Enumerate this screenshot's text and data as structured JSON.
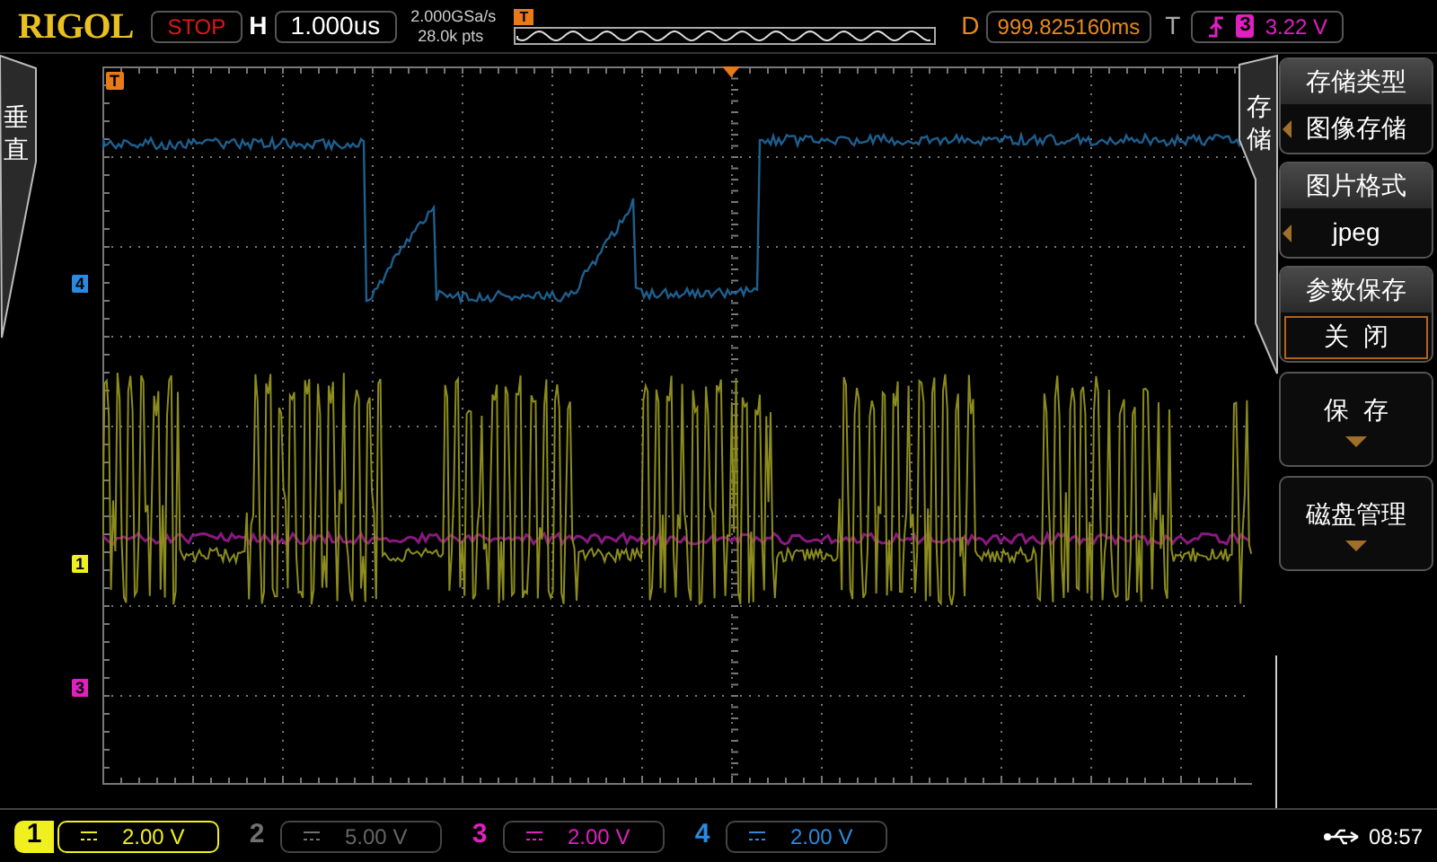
{
  "header": {
    "logo": "RIGOL",
    "run_state": "STOP",
    "timebase_label": "H",
    "timebase": "1.000us",
    "sample_rate": "2.000GSa/s",
    "memory_depth": "28.0k pts",
    "overview_trigger_mark": "T",
    "delay_label": "D",
    "delay": "999.825160ms",
    "trigger_label": "T",
    "trigger_source": "3",
    "trigger_level": "3.22 V"
  },
  "left_tab": {
    "label": "垂直"
  },
  "markers": [
    {
      "kind": "trigger",
      "label": "T",
      "color": "#e87a1a"
    },
    {
      "kind": "channel",
      "label": "4",
      "color": "#2a8ae0"
    },
    {
      "kind": "channel",
      "label": "1",
      "color": "#f0f020"
    },
    {
      "kind": "channel",
      "label": "3",
      "color": "#e020c0"
    }
  ],
  "menu": {
    "tab": "存储",
    "items": [
      {
        "kind": "option",
        "title": "存储类型",
        "value": "图像存储",
        "selected": false
      },
      {
        "kind": "option",
        "title": "图片格式",
        "value": "jpeg",
        "selected": false
      },
      {
        "kind": "option",
        "title": "参数保存",
        "value": "关  闭",
        "selected": true
      },
      {
        "kind": "action",
        "title": "保  存"
      },
      {
        "kind": "action",
        "title": "磁盘管理"
      }
    ]
  },
  "channels": [
    {
      "label": "1",
      "scale": "2.00 V",
      "color": "#f0f020",
      "on": true,
      "selected": true
    },
    {
      "label": "2",
      "scale": "5.00 V",
      "color": "#707070",
      "on": false,
      "selected": false
    },
    {
      "label": "3",
      "scale": "2.00 V",
      "color": "#e020c0",
      "on": true,
      "selected": false
    },
    {
      "label": "4",
      "scale": "2.00 V",
      "color": "#2a8ae0",
      "on": true,
      "selected": false
    }
  ],
  "clock": "08:57"
}
